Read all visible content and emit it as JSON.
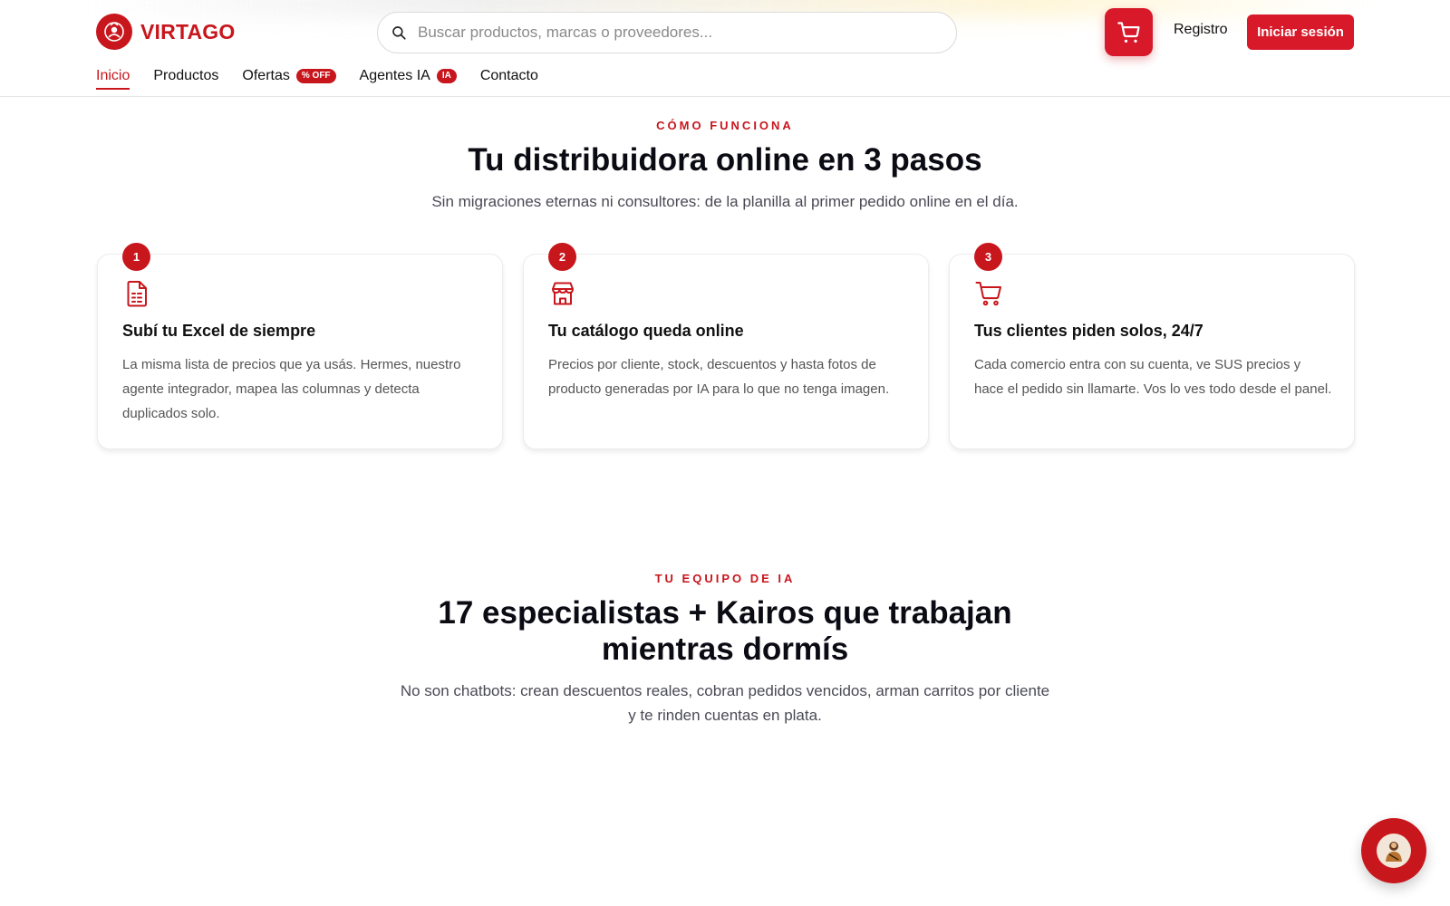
{
  "header": {
    "brand": "VIRTAGO",
    "search_placeholder": "Buscar productos, marcas o proveedores...",
    "register_label": "Registro",
    "login_label": "Iniciar sesión",
    "accent_color": "#c8161d"
  },
  "nav": {
    "items": [
      {
        "label": "Inicio",
        "active": true
      },
      {
        "label": "Productos"
      },
      {
        "label": "Ofertas",
        "badge": "% OFF"
      },
      {
        "label": "Agentes IA",
        "badge": "IA"
      },
      {
        "label": "Contacto"
      }
    ]
  },
  "how": {
    "eyebrow": "CÓMO FUNCIONA",
    "title": "Tu distribuidora online en 3 pasos",
    "subtitle": "Sin migraciones eternas ni consultores: de la planilla al primer pedido online en el día.",
    "steps": [
      {
        "number": "1",
        "icon": "file-spreadsheet-icon",
        "title": "Subí tu Excel de siempre",
        "text": "La misma lista de precios que ya usás. Hermes, nuestro agente integrador, mapea las columnas y detecta duplicados solo."
      },
      {
        "number": "2",
        "icon": "store-icon",
        "title": "Tu catálogo queda online",
        "text": "Precios por cliente, stock, descuentos y hasta fotos de producto generadas por IA para lo que no tenga imagen."
      },
      {
        "number": "3",
        "icon": "cart-icon",
        "title": "Tus clientes piden solos, 24/7",
        "text": "Cada comercio entra con su cuenta, ve SUS precios y hace el pedido sin llamarte. Vos lo ves todo desde el panel."
      }
    ]
  },
  "team": {
    "eyebrow": "TU EQUIPO DE IA",
    "title_line1": "17 especialistas + Kairos que trabajan",
    "title_line2": "mientras dormís",
    "subtitle_line1": "No son chatbots: crean descuentos reales, cobran pedidos vencidos, arman carritos por cliente",
    "subtitle_line2": "y te rinden cuentas en plata."
  }
}
